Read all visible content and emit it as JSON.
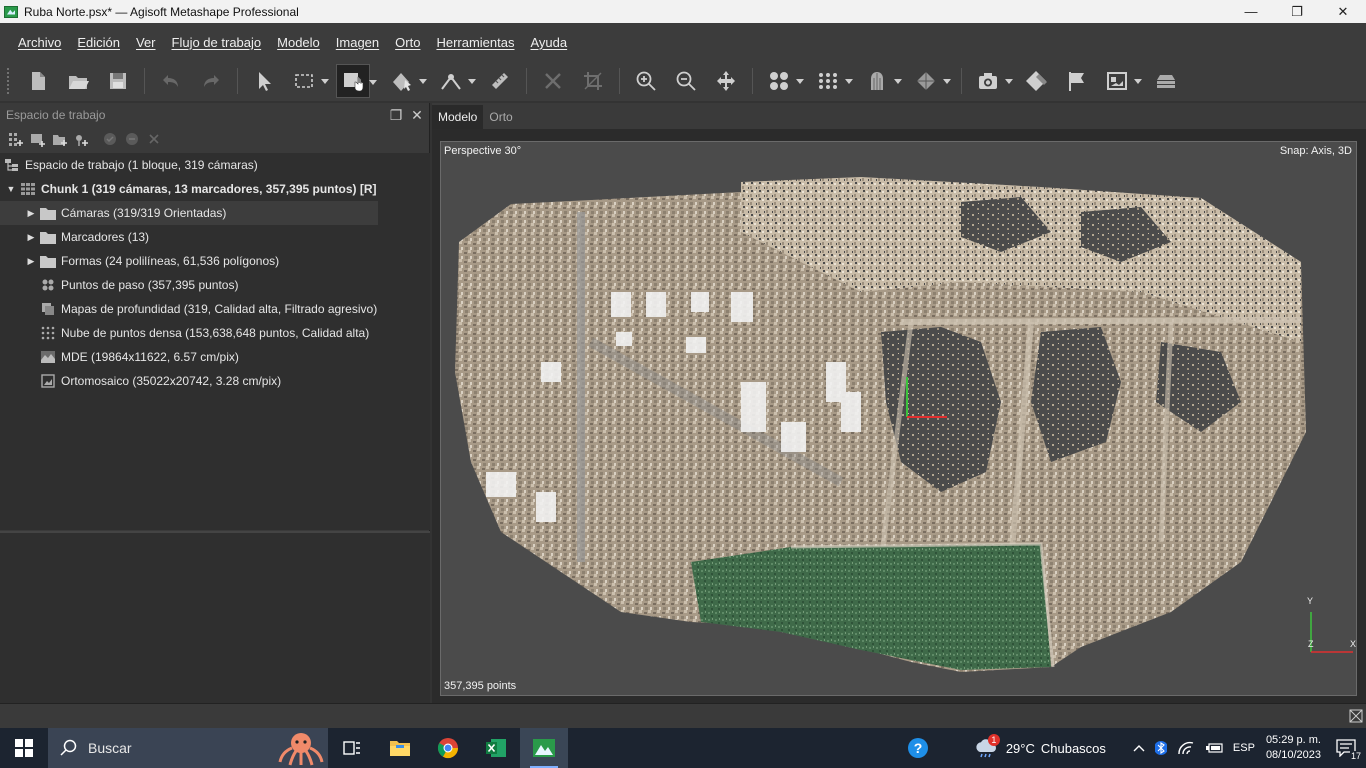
{
  "window": {
    "title": "Ruba Norte.psx* — Agisoft Metashape Professional",
    "controls": [
      "—",
      "❐",
      "✕"
    ]
  },
  "menu": [
    "Archivo",
    "Edición",
    "Ver",
    "Flujo de trabajo",
    "Modelo",
    "Imagen",
    "Orto",
    "Herramientas",
    "Ayuda"
  ],
  "workspace": {
    "title": "Espacio de trabajo",
    "root": "Espacio de trabajo (1 bloque, 319 cámaras)",
    "chunk": "Chunk 1 (319 cámaras, 13 marcadores, 357,395 puntos) [R]",
    "items": [
      "Cámaras (319/319 Orientadas)",
      "Marcadores (13)",
      "Formas (24 polilíneas, 61,536 polígonos)",
      "Puntos de paso (357,395 puntos)",
      "Mapas de profundidad (319, Calidad alta, Filtrado agresivo)",
      "Nube de puntos densa (153,638,648 puntos, Calidad alta)",
      "MDE (19864x11622, 6.57 cm/pix)",
      "Ortomosaico (35022x20742, 3.28 cm/pix)"
    ]
  },
  "viewport": {
    "tabs": [
      "Modelo",
      "Orto"
    ],
    "perspective": "Perspective 30°",
    "snap": "Snap: Axis, 3D",
    "points": "357,395 points",
    "axis": {
      "y": "Y",
      "z": "Z",
      "x": "X"
    }
  },
  "taskbar": {
    "search_placeholder": "Buscar",
    "weather_temp": "29°C",
    "weather_desc": "Chubascos",
    "weather_badge": "1",
    "lang": "ESP",
    "time": "05:29 p. m.",
    "date": "08/10/2023",
    "notifications": "17"
  }
}
